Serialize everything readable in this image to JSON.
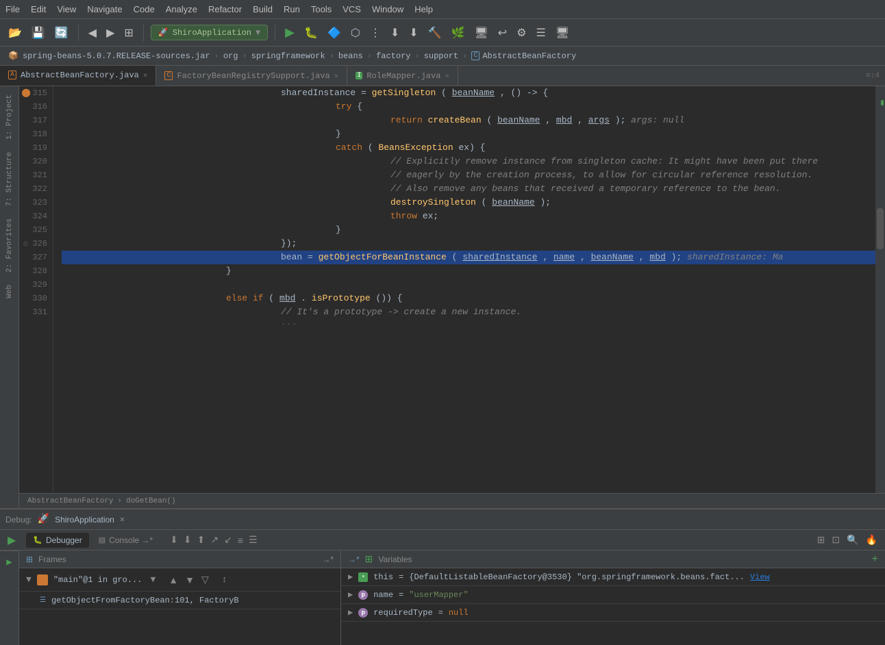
{
  "menubar": {
    "items": [
      "File",
      "Edit",
      "View",
      "Navigate",
      "Code",
      "Analyze",
      "Refactor",
      "Build",
      "Run",
      "Tools",
      "VCS",
      "Window",
      "Help"
    ]
  },
  "breadcrumb": {
    "items": [
      "spring-beans-5.0.7.RELEASE-sources.jar",
      "org",
      "springframework",
      "beans",
      "factory",
      "support",
      "AbstractBeanFactory"
    ]
  },
  "tabs": [
    {
      "label": "AbstractBeanFactory.java",
      "active": true,
      "icon": "A"
    },
    {
      "label": "FactoryBeanRegistrySupport.java",
      "active": false,
      "icon": "C"
    },
    {
      "label": "RoleMapper.java",
      "active": false,
      "icon": "I"
    }
  ],
  "code": {
    "lines": [
      {
        "num": 315,
        "gutter": "arrow",
        "content": "sharedInstance = getSingleton(beanName, () -> {",
        "indent": 16
      },
      {
        "num": 316,
        "gutter": "",
        "content": "try {",
        "indent": 20
      },
      {
        "num": 317,
        "gutter": "",
        "content": "return createBean(beanName, mbd, args);  args: null",
        "indent": 24
      },
      {
        "num": 318,
        "gutter": "",
        "content": "}",
        "indent": 20
      },
      {
        "num": 319,
        "gutter": "",
        "content": "catch (BeansException ex) {",
        "indent": 20
      },
      {
        "num": 320,
        "gutter": "",
        "content": "// Explicitly remove instance from singleton cache: It might have been put there",
        "indent": 24
      },
      {
        "num": 321,
        "gutter": "",
        "content": "// eagerly by the creation process, to allow for circular reference resolution.",
        "indent": 24
      },
      {
        "num": 322,
        "gutter": "",
        "content": "// Also remove any beans that received a temporary reference to the bean.",
        "indent": 24
      },
      {
        "num": 323,
        "gutter": "",
        "content": "destroySingleton(beanName);",
        "indent": 24
      },
      {
        "num": 324,
        "gutter": "",
        "content": "throw ex;",
        "indent": 24
      },
      {
        "num": 325,
        "gutter": "",
        "content": "}",
        "indent": 20
      },
      {
        "num": 326,
        "gutter": "fold",
        "content": "});",
        "indent": 16
      },
      {
        "num": 327,
        "gutter": "",
        "content": "bean = getObjectForBeanInstance(sharedInstance, name, beanName, mbd);  sharedInstance: Ma",
        "indent": 16,
        "highlight": true
      },
      {
        "num": 328,
        "gutter": "",
        "content": "}",
        "indent": 12
      },
      {
        "num": 329,
        "gutter": "",
        "content": "",
        "indent": 0
      },
      {
        "num": 330,
        "gutter": "",
        "content": "else if (mbd.isPrototype()) {",
        "indent": 12
      },
      {
        "num": 331,
        "gutter": "",
        "content": "// It's a prototype -> create a new instance.",
        "indent": 16
      }
    ]
  },
  "code_breadcrumb": {
    "class": "AbstractBeanFactory",
    "method": "doGetBean()"
  },
  "debug": {
    "title": "Debug:",
    "app_name": "ShiroApplication",
    "tabs": [
      "Debugger",
      "Console →*"
    ],
    "active_tab": "Debugger",
    "frames_title": "Frames",
    "variables_title": "Variables",
    "thread": {
      "name": "\"main\"@1 in gro...",
      "icon": "▶"
    },
    "frames": [
      {
        "text": "getObjectFromFactoryBean:101, FactoryB",
        "dim": false
      }
    ],
    "variables": [
      {
        "name": "this",
        "value": "= {DefaultListableBeanFactory@3530} \"org.springframework.beans.fact...",
        "icon": "rect",
        "link": "View"
      },
      {
        "name": "name",
        "value": "= \"userMapper\"",
        "icon": "p",
        "type": "str"
      },
      {
        "name": "requiredType",
        "value": "= null",
        "icon": "p",
        "type": "null"
      }
    ]
  },
  "sidebar_left": {
    "tabs": [
      "1: Project",
      "7: Structure",
      "2: Favorites",
      "Web"
    ]
  },
  "run_config": {
    "label": "ShiroApplication"
  }
}
